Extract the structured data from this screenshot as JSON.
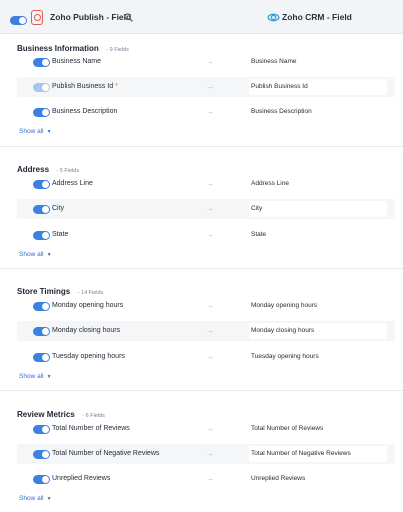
{
  "header": {
    "left_title": "Zoho Publish - Field",
    "right_title": "Zoho CRM - Field",
    "search_icon": "search-icon",
    "colors": {
      "accent": "#3b82e0",
      "brand_red": "#e35a5a",
      "header_bg": "#f3f4f7"
    }
  },
  "arrow_glyph": "→",
  "sections": [
    {
      "title": "Business Information",
      "count": "- 9 Fields",
      "show_all": "Show all",
      "rows": [
        {
          "source": "Business Name",
          "target": "Business Name",
          "enabled": true,
          "required": false
        },
        {
          "source": "Publish Business Id",
          "required_mark": "*",
          "target": "Publish Business Id",
          "enabled": true,
          "required": true
        },
        {
          "source": "Business Description",
          "target": "Business Description",
          "enabled": true,
          "required": false
        }
      ]
    },
    {
      "title": "Address",
      "count": "- 5 Fields",
      "show_all": "Show all",
      "rows": [
        {
          "source": "Address Line",
          "target": "Address Line",
          "enabled": true
        },
        {
          "source": "City",
          "target": "City",
          "enabled": true
        },
        {
          "source": "State",
          "target": "State",
          "enabled": true
        }
      ]
    },
    {
      "title": "Store Timings",
      "count": "- 14 Fields",
      "show_all": "Show all",
      "rows": [
        {
          "source": "Monday opening hours",
          "target": "Monday opening hours",
          "enabled": true
        },
        {
          "source": "Monday closing hours",
          "target": "Monday closing hours",
          "enabled": true
        },
        {
          "source": "Tuesday opening hours",
          "target": "Tuesday opening hours",
          "enabled": true
        }
      ]
    },
    {
      "title": "Review Metrics",
      "count": "- 6 Fields",
      "show_all": "Show all",
      "rows": [
        {
          "source": "Total Number of Reviews",
          "target": "Total Number of Reviews",
          "enabled": true
        },
        {
          "source": "Total Number of Negative Reviews",
          "target": "Total Number of Negative Reviews",
          "enabled": true
        },
        {
          "source": "Unreplied Reviews",
          "target": "Unreplied Reviews",
          "enabled": true
        }
      ]
    }
  ]
}
